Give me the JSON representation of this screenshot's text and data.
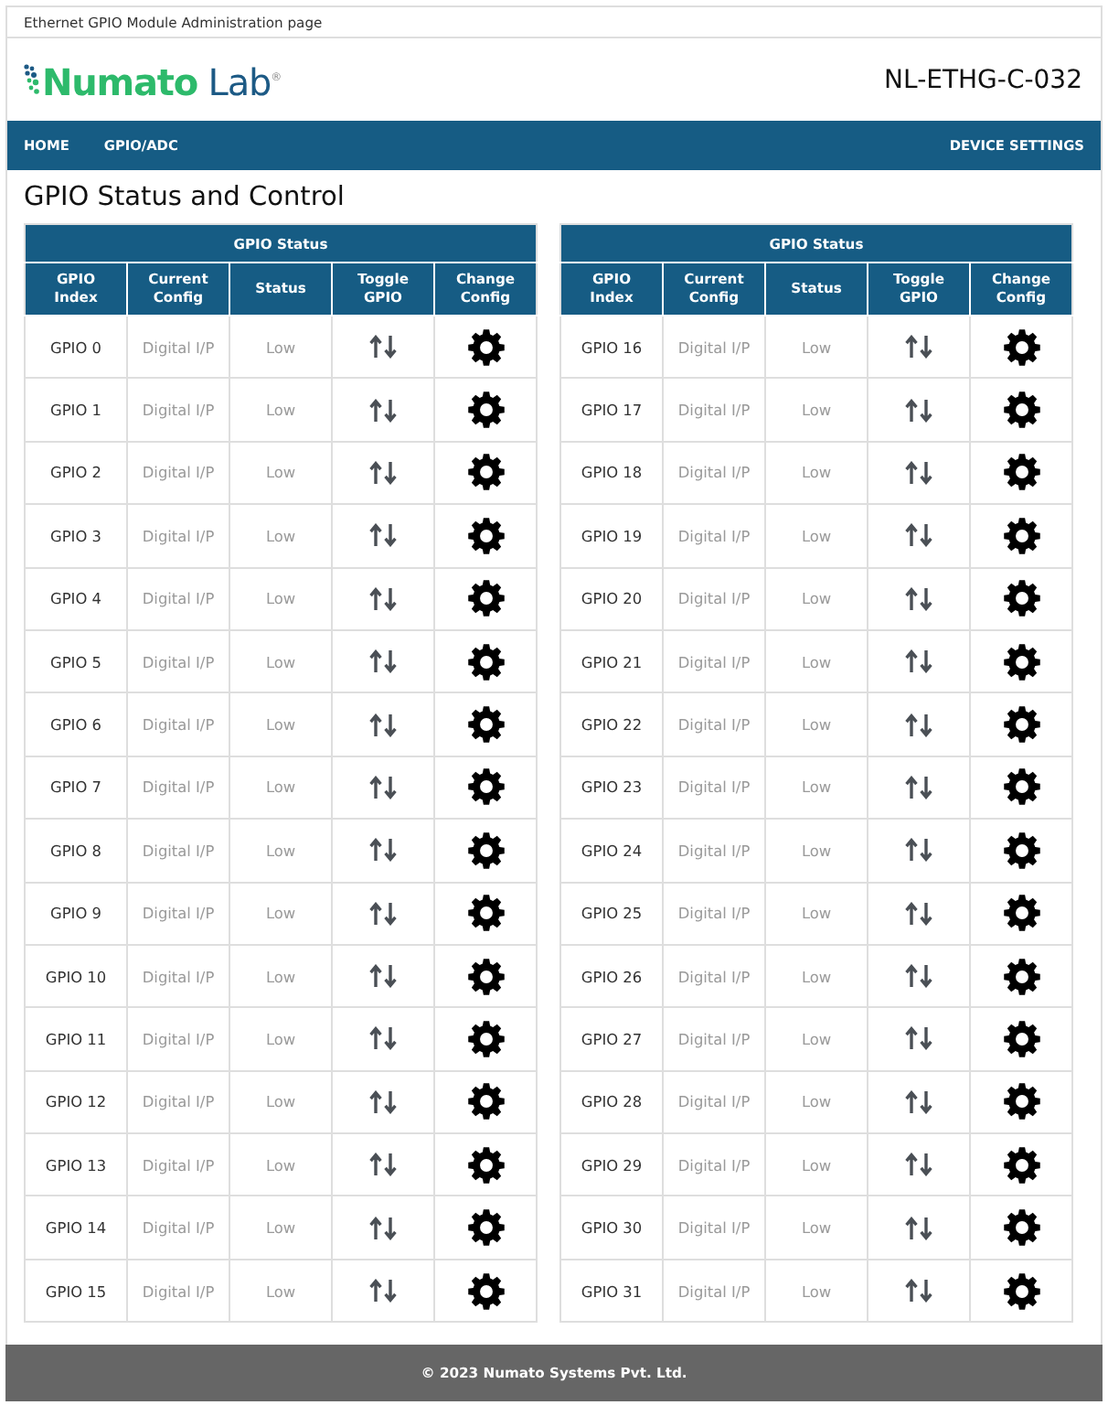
{
  "page_title": "Ethernet GPIO Module Administration page",
  "header": {
    "logo": {
      "brand": "Numato",
      "suffix": "Lab",
      "mark": "®"
    },
    "device_name": "NL-ETHG-C-032"
  },
  "nav": {
    "left": [
      {
        "label": "HOME"
      },
      {
        "label": "GPIO/ADC"
      }
    ],
    "right": [
      {
        "label": "DEVICE SETTINGS"
      }
    ]
  },
  "heading": "GPIO Status and Control",
  "tables": [
    {
      "title": "GPIO Status",
      "columns": [
        "GPIO Index",
        "Current Config",
        "Status",
        "Toggle GPIO",
        "Change Config"
      ],
      "rows": [
        {
          "index": "GPIO 0",
          "config": "Digital I/P",
          "status": "Low"
        },
        {
          "index": "GPIO 1",
          "config": "Digital I/P",
          "status": "Low"
        },
        {
          "index": "GPIO 2",
          "config": "Digital I/P",
          "status": "Low"
        },
        {
          "index": "GPIO 3",
          "config": "Digital I/P",
          "status": "Low"
        },
        {
          "index": "GPIO 4",
          "config": "Digital I/P",
          "status": "Low"
        },
        {
          "index": "GPIO 5",
          "config": "Digital I/P",
          "status": "Low"
        },
        {
          "index": "GPIO 6",
          "config": "Digital I/P",
          "status": "Low"
        },
        {
          "index": "GPIO 7",
          "config": "Digital I/P",
          "status": "Low"
        },
        {
          "index": "GPIO 8",
          "config": "Digital I/P",
          "status": "Low"
        },
        {
          "index": "GPIO 9",
          "config": "Digital I/P",
          "status": "Low"
        },
        {
          "index": "GPIO 10",
          "config": "Digital I/P",
          "status": "Low"
        },
        {
          "index": "GPIO 11",
          "config": "Digital I/P",
          "status": "Low"
        },
        {
          "index": "GPIO 12",
          "config": "Digital I/P",
          "status": "Low"
        },
        {
          "index": "GPIO 13",
          "config": "Digital I/P",
          "status": "Low"
        },
        {
          "index": "GPIO 14",
          "config": "Digital I/P",
          "status": "Low"
        },
        {
          "index": "GPIO 15",
          "config": "Digital I/P",
          "status": "Low"
        }
      ]
    },
    {
      "title": "GPIO Status",
      "columns": [
        "GPIO Index",
        "Current Config",
        "Status",
        "Toggle GPIO",
        "Change Config"
      ],
      "rows": [
        {
          "index": "GPIO 16",
          "config": "Digital I/P",
          "status": "Low"
        },
        {
          "index": "GPIO 17",
          "config": "Digital I/P",
          "status": "Low"
        },
        {
          "index": "GPIO 18",
          "config": "Digital I/P",
          "status": "Low"
        },
        {
          "index": "GPIO 19",
          "config": "Digital I/P",
          "status": "Low"
        },
        {
          "index": "GPIO 20",
          "config": "Digital I/P",
          "status": "Low"
        },
        {
          "index": "GPIO 21",
          "config": "Digital I/P",
          "status": "Low"
        },
        {
          "index": "GPIO 22",
          "config": "Digital I/P",
          "status": "Low"
        },
        {
          "index": "GPIO 23",
          "config": "Digital I/P",
          "status": "Low"
        },
        {
          "index": "GPIO 24",
          "config": "Digital I/P",
          "status": "Low"
        },
        {
          "index": "GPIO 25",
          "config": "Digital I/P",
          "status": "Low"
        },
        {
          "index": "GPIO 26",
          "config": "Digital I/P",
          "status": "Low"
        },
        {
          "index": "GPIO 27",
          "config": "Digital I/P",
          "status": "Low"
        },
        {
          "index": "GPIO 28",
          "config": "Digital I/P",
          "status": "Low"
        },
        {
          "index": "GPIO 29",
          "config": "Digital I/P",
          "status": "Low"
        },
        {
          "index": "GPIO 30",
          "config": "Digital I/P",
          "status": "Low"
        },
        {
          "index": "GPIO 31",
          "config": "Digital I/P",
          "status": "Low"
        }
      ]
    }
  ],
  "footer": "© 2023 Numato Systems Pvt. Ltd."
}
